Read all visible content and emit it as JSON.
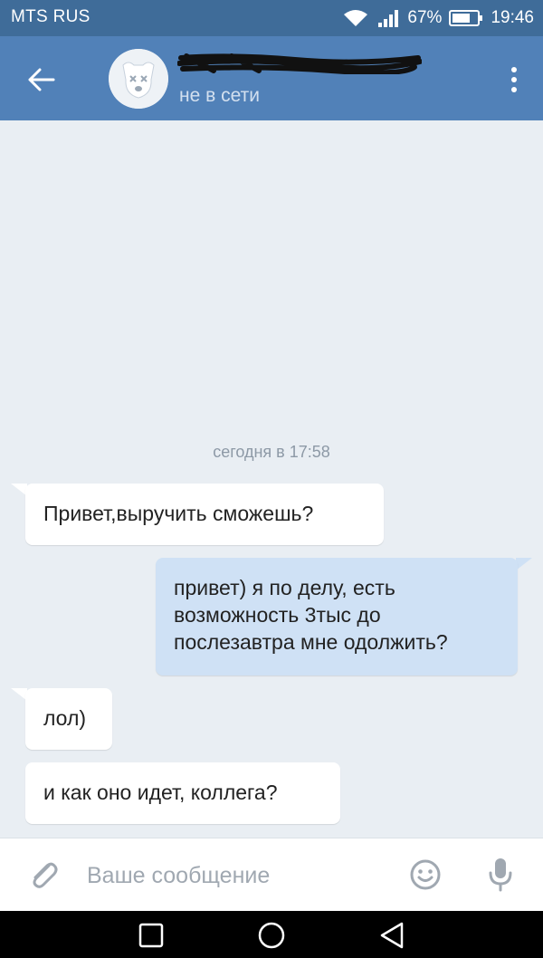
{
  "status_bar": {
    "carrier": "MTS RUS",
    "battery": "67%",
    "time": "19:46"
  },
  "header": {
    "contact_status": "не в сети"
  },
  "chat": {
    "date_separator": "сегодня в 17:58",
    "messages": [
      {
        "direction": "incoming",
        "lines": [
          "Привет,выручить сможешь?"
        ]
      },
      {
        "direction": "outgoing",
        "lines": [
          "привет) я по делу, есть",
          "возможность 3тыс до",
          "послезавтра мне одолжить?"
        ]
      },
      {
        "direction": "incoming",
        "lines": [
          "лол)"
        ]
      },
      {
        "direction": "incoming",
        "lines": [
          "и как оно идет, коллега?"
        ]
      }
    ]
  },
  "composer": {
    "placeholder": "Ваше сообщение"
  },
  "colors": {
    "header_bg": "#5181b8",
    "status_bar_bg": "#3f6c99",
    "chat_bg": "#e9eef3",
    "incoming_bubble": "#ffffff",
    "outgoing_bubble": "#cfe1f5"
  }
}
